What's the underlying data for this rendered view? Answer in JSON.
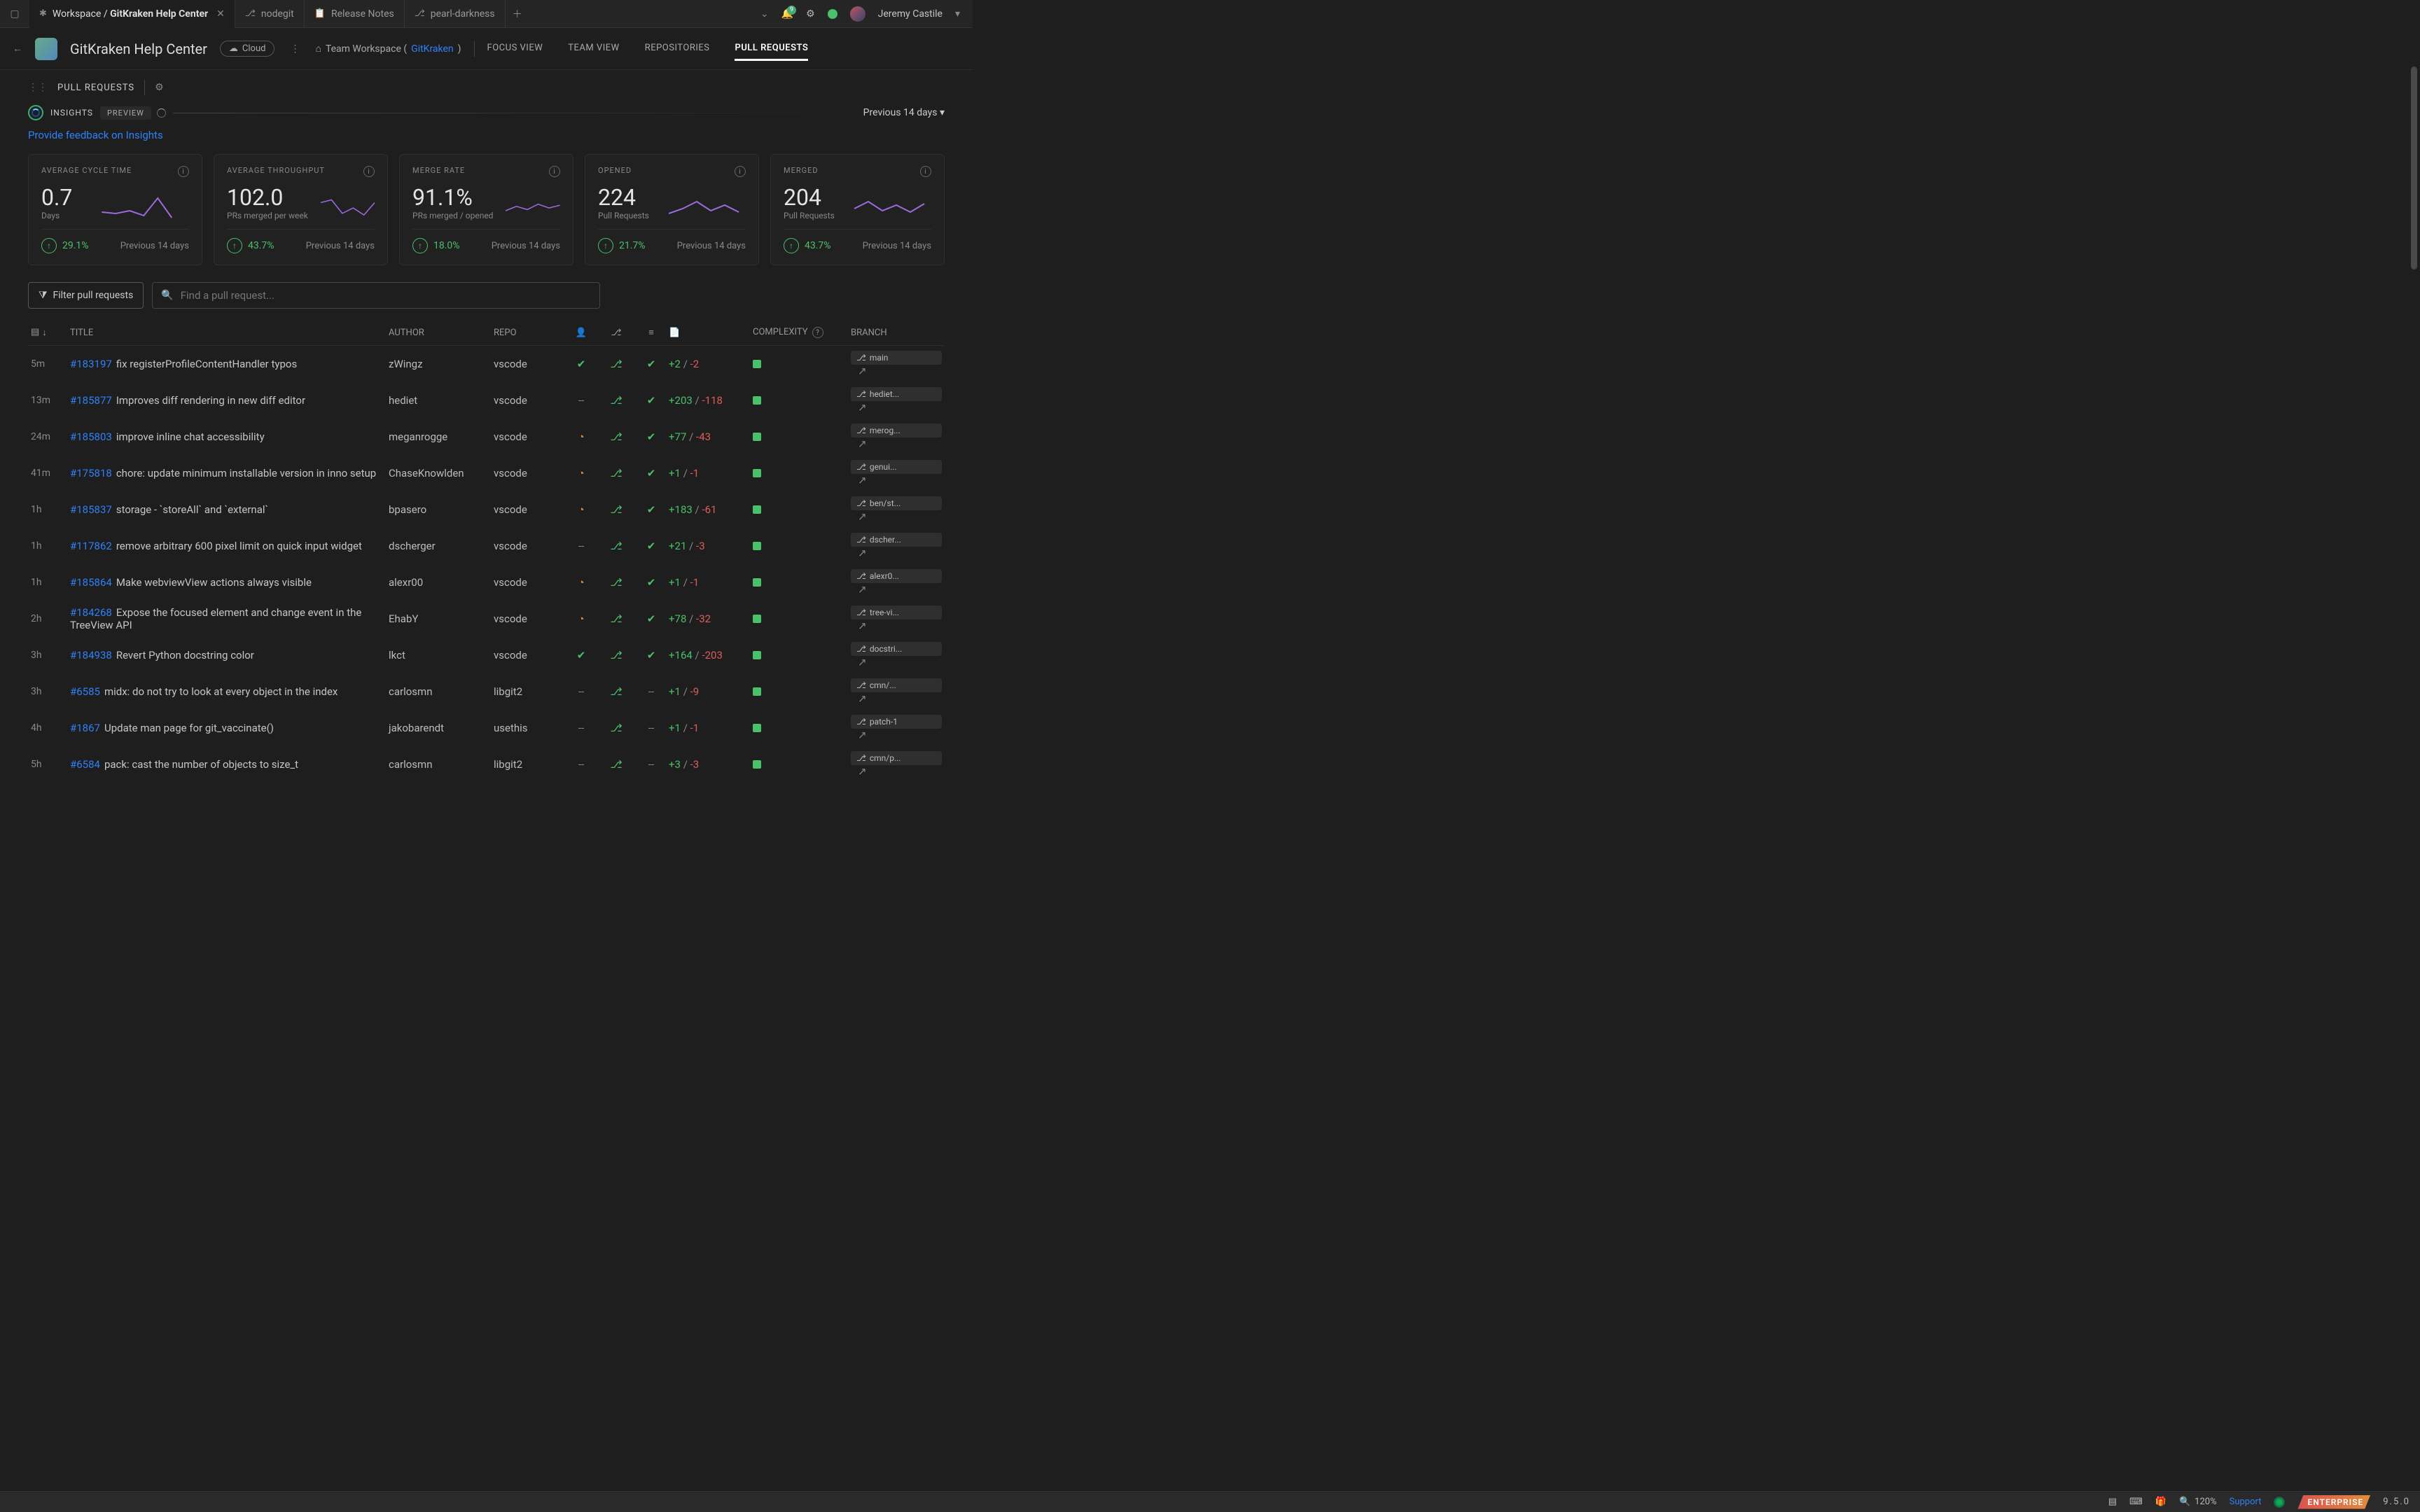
{
  "tabs": {
    "items": [
      {
        "icon": "✱",
        "label": "Workspace / ",
        "bold": "GitKraken Help Center",
        "active": true
      },
      {
        "icon": "⎇",
        "label": "nodegit"
      },
      {
        "icon": "📋",
        "label": "Release Notes"
      },
      {
        "icon": "⎇",
        "label": "pearl-darkness"
      }
    ]
  },
  "topright": {
    "bell_count": "9",
    "user": "Jeremy Castile"
  },
  "header": {
    "title": "GitKraken Help Center",
    "cloud": "Cloud",
    "team_prefix": "Team Workspace (",
    "team_link": "GitKraken",
    "team_suffix": ")",
    "nav": [
      "FOCUS VIEW",
      "TEAM VIEW",
      "REPOSITORIES",
      "PULL REQUESTS"
    ],
    "nav_active": 3
  },
  "subbar": {
    "title": "PULL REQUESTS"
  },
  "insights": {
    "label": "INSIGHTS",
    "preview": "PREVIEW",
    "period": "Previous 14 days"
  },
  "feedback": "Provide feedback on Insights",
  "cards": [
    {
      "title": "AVERAGE CYCLE TIME",
      "value": "0.7",
      "sub": "Days",
      "trend": "29.1%",
      "prev": "Previous 14 days"
    },
    {
      "title": "AVERAGE THROUGHPUT",
      "value": "102.0",
      "sub": "PRs merged per week",
      "trend": "43.7%",
      "prev": "Previous 14 days"
    },
    {
      "title": "MERGE RATE",
      "value": "91.1%",
      "sub": "PRs merged / opened",
      "trend": "18.0%",
      "prev": "Previous 14 days"
    },
    {
      "title": "OPENED",
      "value": "224",
      "sub": "Pull Requests",
      "trend": "21.7%",
      "prev": "Previous 14 days"
    },
    {
      "title": "MERGED",
      "value": "204",
      "sub": "Pull Requests",
      "trend": "43.7%",
      "prev": "Previous 14 days"
    }
  ],
  "filter_btn": "Filter pull requests",
  "search_placeholder": "Find a pull request...",
  "columns": {
    "title": "TITLE",
    "author": "AUTHOR",
    "repo": "REPO",
    "complexity": "COMPLEXITY",
    "branch": "BRANCH"
  },
  "rows": [
    {
      "t": "5m",
      "id": "#183197",
      "title": "fix registerProfileContentHandler typos",
      "auth": "zWingz",
      "repo": "vscode",
      "s1": "g",
      "s3": "g",
      "p": "+2",
      "m": "-2",
      "br": "main"
    },
    {
      "t": "13m",
      "id": "#185877",
      "title": "Improves diff rendering in new diff editor",
      "auth": "hediet",
      "repo": "vscode",
      "s1": "-",
      "s3": "g",
      "p": "+203",
      "m": "-118",
      "br": "hediet..."
    },
    {
      "t": "24m",
      "id": "#185803",
      "title": "improve inline chat accessibility",
      "auth": "meganrogge",
      "repo": "vscode",
      "s1": "o",
      "s3": "g",
      "p": "+77",
      "m": "-43",
      "br": "merog..."
    },
    {
      "t": "41m",
      "id": "#175818",
      "title": "chore: update minimum installable version in inno setup",
      "auth": "ChaseKnowlden",
      "repo": "vscode",
      "s1": "o",
      "s3": "g",
      "p": "+1",
      "m": "-1",
      "br": "genui..."
    },
    {
      "t": "1h",
      "id": "#185837",
      "title": "storage - `storeAll` and `external`",
      "auth": "bpasero",
      "repo": "vscode",
      "s1": "o",
      "s3": "g",
      "p": "+183",
      "m": "-61",
      "br": "ben/st..."
    },
    {
      "t": "1h",
      "id": "#117862",
      "title": "remove arbitrary 600 pixel limit on quick input widget",
      "auth": "dscherger",
      "repo": "vscode",
      "s1": "-",
      "s3": "g",
      "p": "+21",
      "m": "-3",
      "br": "dscher..."
    },
    {
      "t": "1h",
      "id": "#185864",
      "title": "Make webviewView actions always visible",
      "auth": "alexr00",
      "repo": "vscode",
      "s1": "o",
      "s3": "g",
      "p": "+1",
      "m": "-1",
      "br": "alexr0..."
    },
    {
      "t": "2h",
      "id": "#184268",
      "title": "Expose the focused element and change event in the TreeView API",
      "auth": "EhabY",
      "repo": "vscode",
      "s1": "o",
      "s3": "g",
      "p": "+78",
      "m": "-32",
      "br": "tree-vi..."
    },
    {
      "t": "3h",
      "id": "#184938",
      "title": "Revert Python docstring color",
      "auth": "lkct",
      "repo": "vscode",
      "s1": "g",
      "s3": "g",
      "p": "+164",
      "m": "-203",
      "br": "docstri..."
    },
    {
      "t": "3h",
      "id": "#6585",
      "title": "midx: do not try to look at every object in the index",
      "auth": "carlosmn",
      "repo": "libgit2",
      "s1": "-",
      "s3": "-",
      "p": "+1",
      "m": "-9",
      "br": "cmn/..."
    },
    {
      "t": "4h",
      "id": "#1867",
      "title": "Update man page for git_vaccinate()",
      "auth": "jakobarendt",
      "repo": "usethis",
      "s1": "-",
      "s3": "-",
      "p": "+1",
      "m": "-1",
      "br": "patch-1"
    },
    {
      "t": "5h",
      "id": "#6584",
      "title": "pack: cast the number of objects to size_t",
      "auth": "carlosmn",
      "repo": "libgit2",
      "s1": "-",
      "s3": "-",
      "p": "+3",
      "m": "-3",
      "br": "cmn/p..."
    }
  ],
  "status": {
    "zoom": "120%",
    "support": "Support",
    "enterprise": "ENTERPRISE",
    "ver": "9.5.0"
  }
}
